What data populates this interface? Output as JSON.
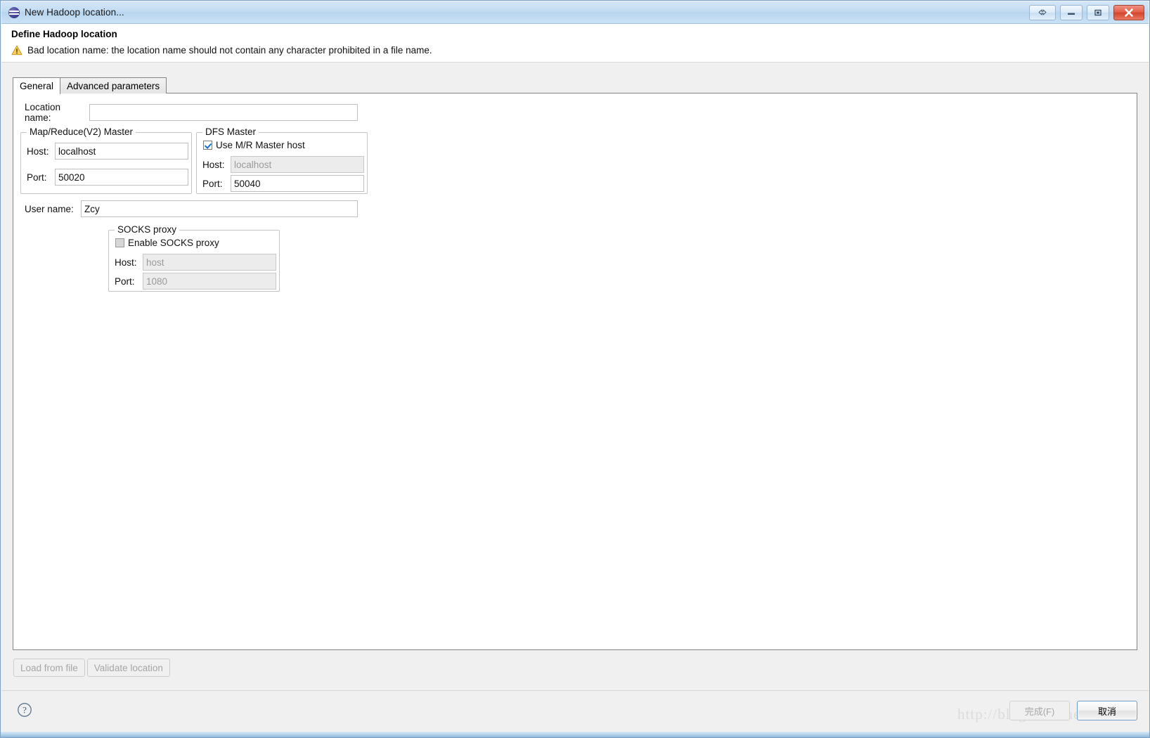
{
  "window": {
    "title": "New Hadoop location...",
    "icon": "eclipse-hadoop-icon",
    "buttons": {
      "restore_label": "restore-arrows-icon",
      "minimize_label": "minimize-icon",
      "maximize_label": "maximize-icon",
      "close_label": "close-icon"
    }
  },
  "header": {
    "title": "Define Hadoop location",
    "message_icon": "warning-icon",
    "message": "Bad location name: the location name should not contain any character prohibited in a file name."
  },
  "tabs": [
    {
      "label": "General",
      "active": true
    },
    {
      "label": "Advanced parameters",
      "active": false
    }
  ],
  "form": {
    "location_name": {
      "label": "Location name:",
      "value": "",
      "placeholder": ""
    },
    "mapreduce_master": {
      "title": "Map/Reduce(V2) Master",
      "host": {
        "label": "Host:",
        "value": "localhost"
      },
      "port": {
        "label": "Port:",
        "value": "50020"
      }
    },
    "dfs_master": {
      "title": "DFS Master",
      "use_mr_master_host": {
        "label": "Use M/R Master host",
        "checked": true
      },
      "host": {
        "label": "Host:",
        "value": "localhost",
        "disabled": true
      },
      "port": {
        "label": "Port:",
        "value": "50040",
        "disabled": false
      }
    },
    "user_name": {
      "label": "User name:",
      "value": "Zcy"
    },
    "socks_proxy": {
      "title": "SOCKS proxy",
      "enable": {
        "label": "Enable SOCKS proxy",
        "checked": false,
        "disabled": true
      },
      "host": {
        "label": "Host:",
        "value": "host",
        "disabled": true
      },
      "port": {
        "label": "Port:",
        "value": "1080",
        "disabled": true
      }
    }
  },
  "panel_buttons": {
    "load_from_file": "Load from file",
    "validate_location": "Validate location"
  },
  "footer": {
    "help_icon": "help-question-icon",
    "finish_button": "完成(F)",
    "cancel_button": "取消"
  },
  "watermark": "http://blog.csdn.net/Iamadk",
  "colors": {
    "titlebar_blue": "#c3dcf2",
    "close_red": "#d2452c",
    "checkbox_blue": "#1a6fd4",
    "warning_yellow": "#f5c242",
    "panel_bg": "#f0f0f0",
    "content_bg": "#ffffff"
  }
}
